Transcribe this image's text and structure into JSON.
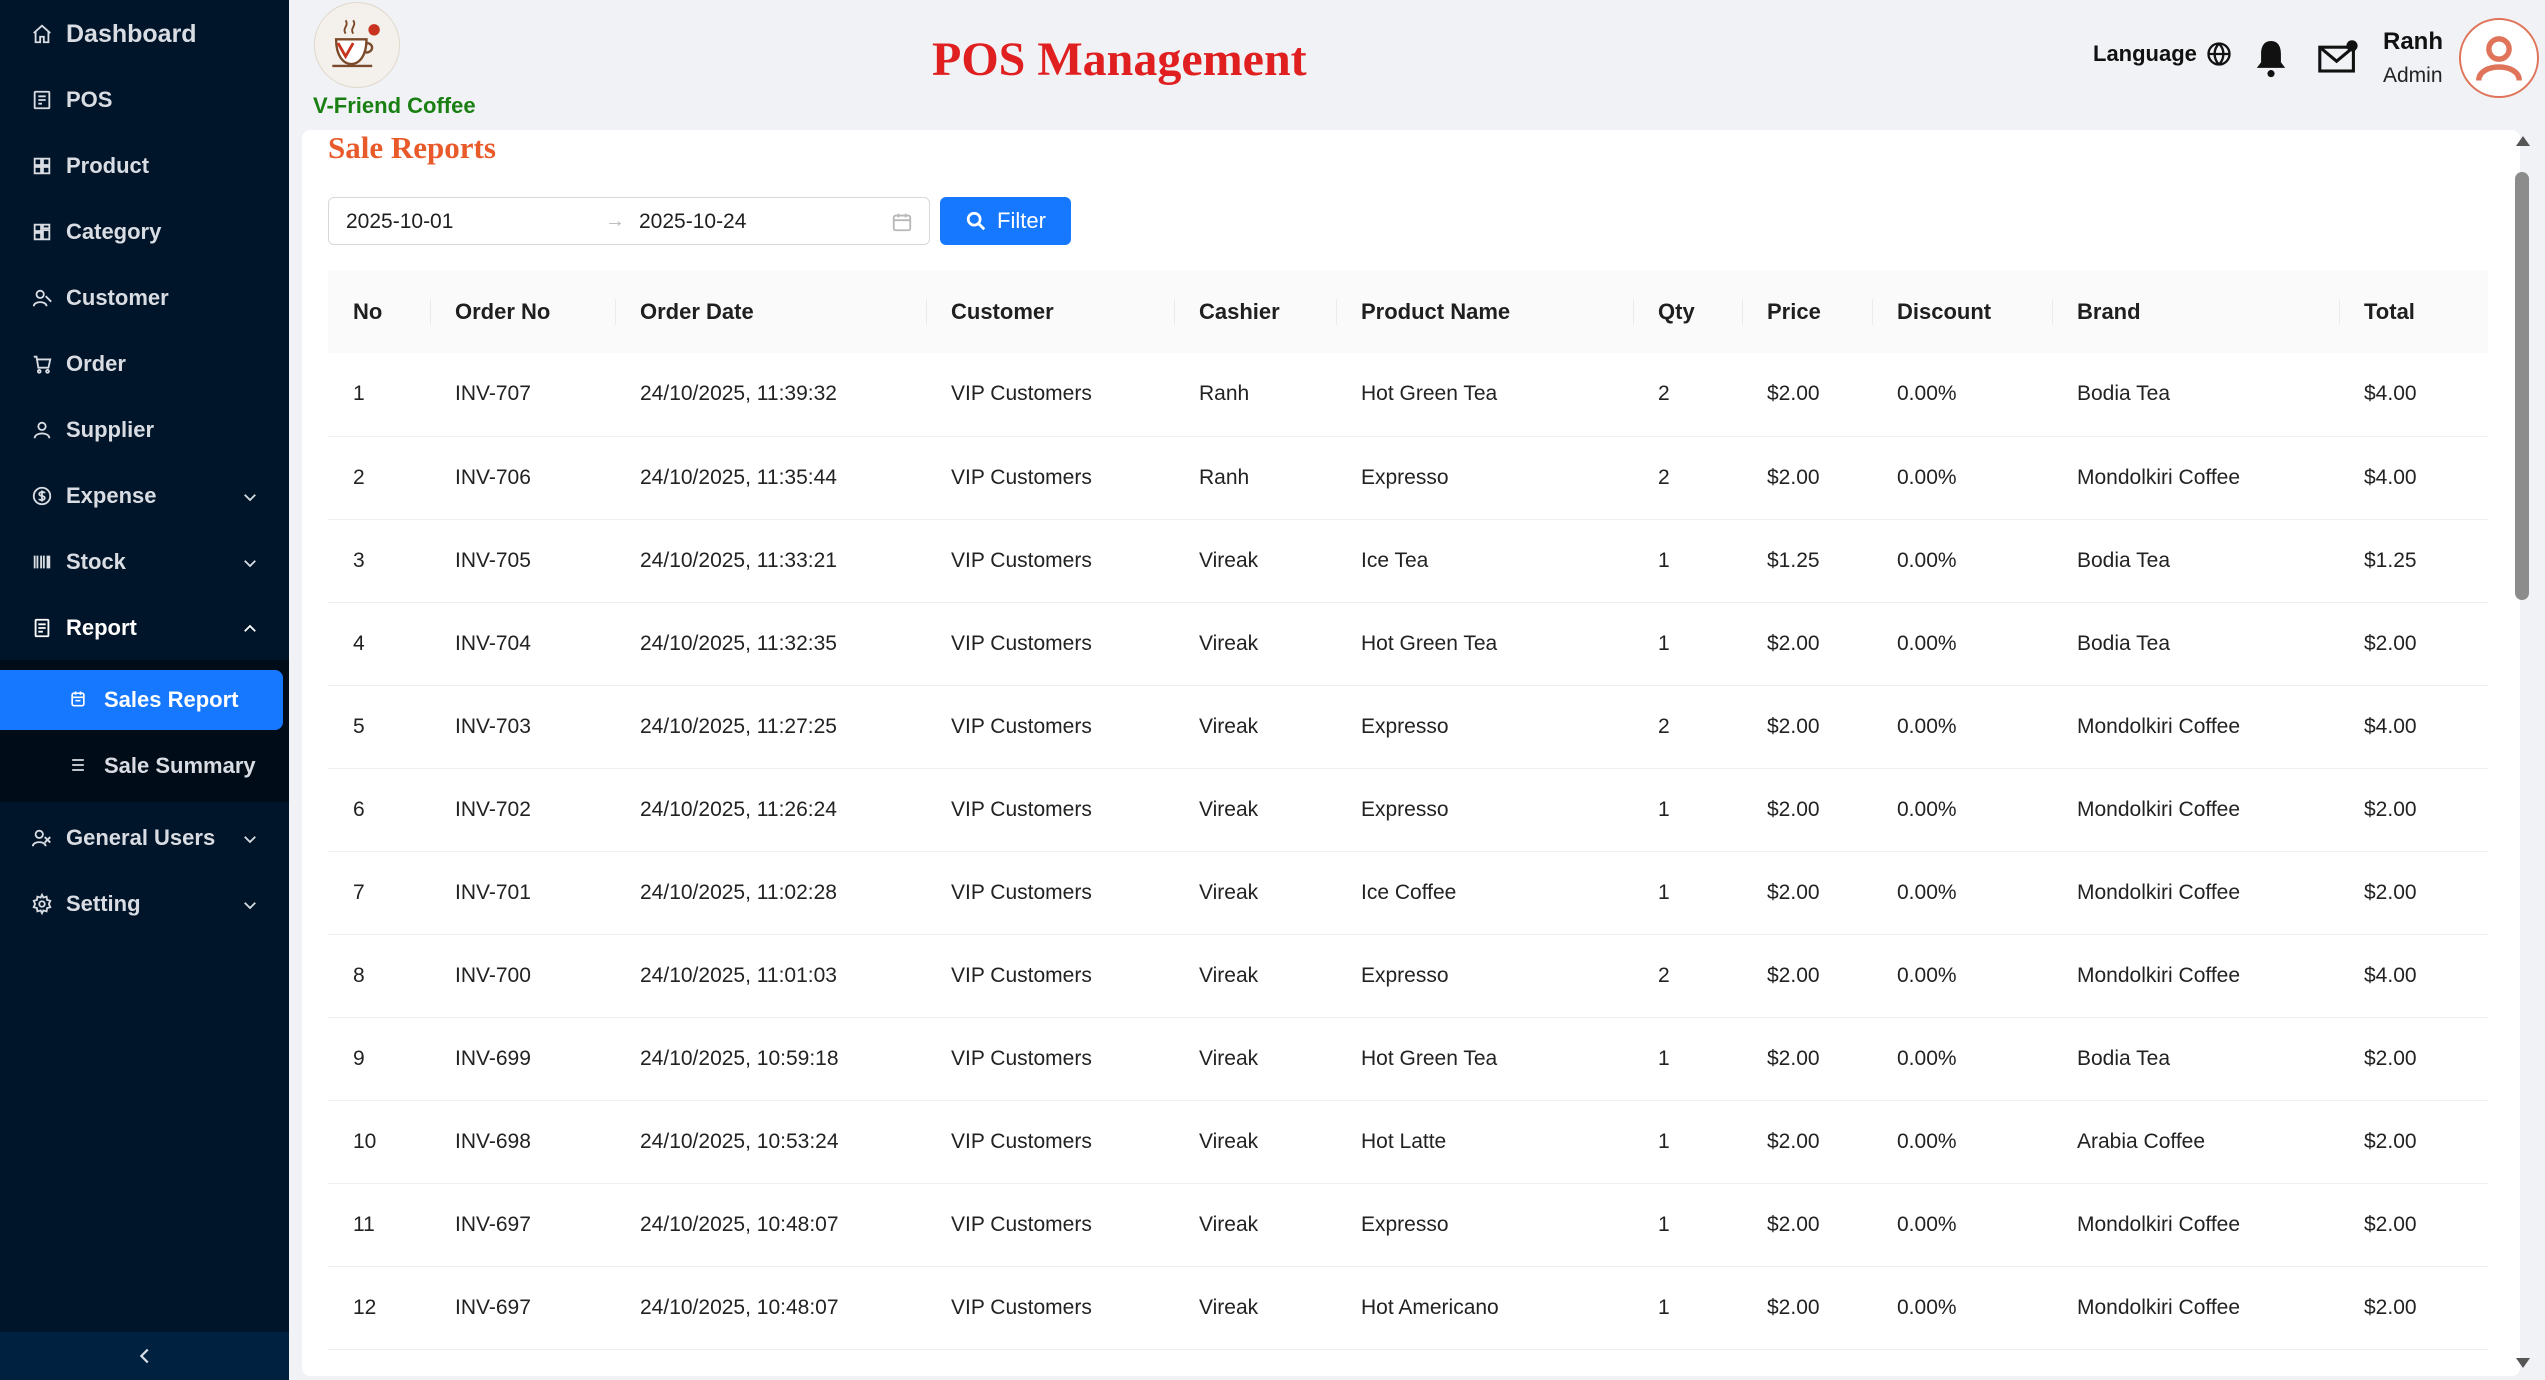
{
  "sidebar": {
    "items": [
      {
        "label": "Dashboard",
        "icon": "home-icon"
      },
      {
        "label": "POS",
        "icon": "pos-icon"
      },
      {
        "label": "Product",
        "icon": "grid-icon"
      },
      {
        "label": "Category",
        "icon": "category-icon"
      },
      {
        "label": "Customer",
        "icon": "customer-icon"
      },
      {
        "label": "Order",
        "icon": "cart-icon"
      },
      {
        "label": "Supplier",
        "icon": "user-icon"
      },
      {
        "label": "Expense",
        "icon": "dollar-icon"
      },
      {
        "label": "Stock",
        "icon": "barcode-icon"
      },
      {
        "label": "Report",
        "icon": "report-icon"
      },
      {
        "label": "General Users",
        "icon": "users-icon"
      },
      {
        "label": "Setting",
        "icon": "gear-icon"
      }
    ],
    "report_submenu": [
      {
        "label": "Sales Report",
        "icon": "calendar-icon",
        "active": true
      },
      {
        "label": "Sale Summary",
        "icon": "list-icon",
        "active": false
      }
    ]
  },
  "header": {
    "brand": "V-Friend Coffee",
    "title": "POS Management",
    "language_label": "Language",
    "user_name": "Ranh",
    "user_role": "Admin"
  },
  "report": {
    "title": "Sale Reports",
    "date_start": "2025-10-01",
    "date_end": "2025-10-24",
    "filter_label": "Filter",
    "columns": [
      "No",
      "Order No",
      "Order Date",
      "Customer",
      "Cashier",
      "Product Name",
      "Qty",
      "Price",
      "Discount",
      "Brand",
      "Total"
    ],
    "rows": [
      [
        "1",
        "INV-707",
        "24/10/2025, 11:39:32",
        "VIP Customers",
        "Ranh",
        "Hot Green Tea",
        "2",
        "$2.00",
        "0.00%",
        "Bodia Tea",
        "$4.00"
      ],
      [
        "2",
        "INV-706",
        "24/10/2025, 11:35:44",
        "VIP Customers",
        "Ranh",
        "Expresso",
        "2",
        "$2.00",
        "0.00%",
        "Mondolkiri Coffee",
        "$4.00"
      ],
      [
        "3",
        "INV-705",
        "24/10/2025, 11:33:21",
        "VIP Customers",
        "Vireak",
        "Ice Tea",
        "1",
        "$1.25",
        "0.00%",
        "Bodia Tea",
        "$1.25"
      ],
      [
        "4",
        "INV-704",
        "24/10/2025, 11:32:35",
        "VIP Customers",
        "Vireak",
        "Hot Green Tea",
        "1",
        "$2.00",
        "0.00%",
        "Bodia Tea",
        "$2.00"
      ],
      [
        "5",
        "INV-703",
        "24/10/2025, 11:27:25",
        "VIP Customers",
        "Vireak",
        "Expresso",
        "2",
        "$2.00",
        "0.00%",
        "Mondolkiri Coffee",
        "$4.00"
      ],
      [
        "6",
        "INV-702",
        "24/10/2025, 11:26:24",
        "VIP Customers",
        "Vireak",
        "Expresso",
        "1",
        "$2.00",
        "0.00%",
        "Mondolkiri Coffee",
        "$2.00"
      ],
      [
        "7",
        "INV-701",
        "24/10/2025, 11:02:28",
        "VIP Customers",
        "Vireak",
        "Ice Coffee",
        "1",
        "$2.00",
        "0.00%",
        "Mondolkiri Coffee",
        "$2.00"
      ],
      [
        "8",
        "INV-700",
        "24/10/2025, 11:01:03",
        "VIP Customers",
        "Vireak",
        "Expresso",
        "2",
        "$2.00",
        "0.00%",
        "Mondolkiri Coffee",
        "$4.00"
      ],
      [
        "9",
        "INV-699",
        "24/10/2025, 10:59:18",
        "VIP Customers",
        "Vireak",
        "Hot Green Tea",
        "1",
        "$2.00",
        "0.00%",
        "Bodia Tea",
        "$2.00"
      ],
      [
        "10",
        "INV-698",
        "24/10/2025, 10:53:24",
        "VIP Customers",
        "Vireak",
        "Hot Latte",
        "1",
        "$2.00",
        "0.00%",
        "Arabia Coffee",
        "$2.00"
      ],
      [
        "11",
        "INV-697",
        "24/10/2025, 10:48:07",
        "VIP Customers",
        "Vireak",
        "Expresso",
        "1",
        "$2.00",
        "0.00%",
        "Mondolkiri Coffee",
        "$2.00"
      ],
      [
        "12",
        "INV-697",
        "24/10/2025, 10:48:07",
        "VIP Customers",
        "Vireak",
        "Hot Americano",
        "1",
        "$2.00",
        "0.00%",
        "Mondolkiri Coffee",
        "$2.00"
      ]
    ]
  },
  "colors": {
    "sidebar_bg": "#001529",
    "accent": "#1677ff",
    "title_red": "#e02020",
    "report_title": "#e85a2a",
    "brand_green": "#1a7f12"
  }
}
